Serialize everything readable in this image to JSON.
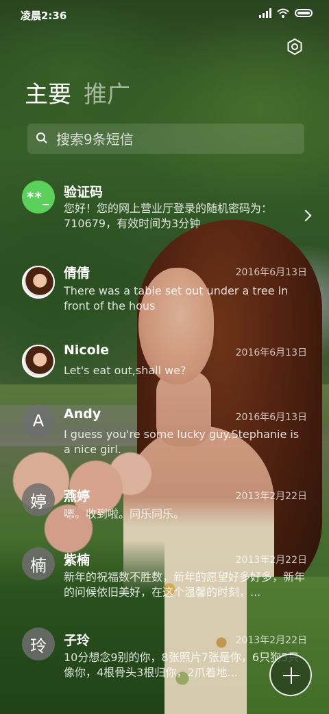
{
  "status_bar": {
    "time": "凌晨2:36"
  },
  "tabs": [
    {
      "label": "主要",
      "active": true
    },
    {
      "label": "推广",
      "active": false
    }
  ],
  "search": {
    "placeholder": "搜索9条短信",
    "value": ""
  },
  "conversations": [
    {
      "avatar_text": "**_",
      "avatar_type": "code",
      "name": "验证码",
      "date": "",
      "preview": "您好！您的网上营业厅登录的随机密码为：710679，有效时间为3分钟",
      "has_chevron": true
    },
    {
      "avatar_text": "",
      "avatar_type": "photo",
      "name": "倩倩",
      "date": "2016年6月13日",
      "preview": "There was a table set out under a tree in front of the hous"
    },
    {
      "avatar_text": "",
      "avatar_type": "photo",
      "name": "Nicole",
      "date": "2016年6月13日",
      "preview": "Let's eat out,shall we?"
    },
    {
      "avatar_text": "A",
      "avatar_type": "letter",
      "name": "Andy",
      "date": "2016年6月13日",
      "preview": "I guess you're some lucky guy.Stephanie is a nice girl."
    },
    {
      "avatar_text": "婷",
      "avatar_type": "letter",
      "name": "燕婷",
      "date": "2013年2月22日",
      "preview": "嗯。收到啦。同乐同乐。"
    },
    {
      "avatar_text": "楠",
      "avatar_type": "letter",
      "name": "紫楠",
      "date": "2013年2月22日",
      "preview": "新年的祝福数不胜数，新年的愿望好多好多，新年的问候依旧美好，在这个温馨的时刻，..."
    },
    {
      "avatar_text": "玲",
      "avatar_type": "letter",
      "name": "子玲",
      "date": "2013年2月22日",
      "preview": "10分想念9别的你，8张照片7张是你，6只狗5只像你，4根骨头3根归你，2爪着地..."
    }
  ],
  "colors": {
    "code_avatar": "#5bd05b",
    "letter_avatar": "#6e6e6e"
  },
  "icons": [
    "settings-gear-icon",
    "search-icon",
    "chevron-right-icon",
    "plus-icon",
    "wifi-icon",
    "signal-icon",
    "battery-icon"
  ]
}
